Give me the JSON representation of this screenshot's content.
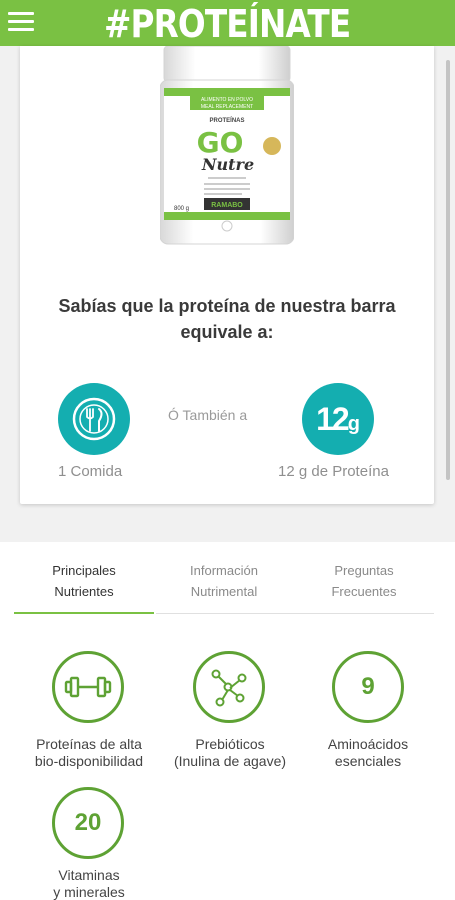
{
  "header": {
    "title": "#PROTEÍNATE",
    "menu_icon": "hamburger-icon"
  },
  "colors": {
    "brand_green": "#7ac143",
    "teal": "#14aeb0",
    "icon_green": "#5ea234"
  },
  "product": {
    "line1": "PROTEÍNAS",
    "brand": "GO",
    "script": "Nutre",
    "banner_top": "ALIMENTO EN POLVO",
    "banner_bottom": "MEAL REPLACEMENT",
    "maker": "RAMABO",
    "weight": "800 g"
  },
  "promo": {
    "line1": "Sabías que la proteína de nuestra barra",
    "line2": "equivale a:"
  },
  "equivalence": {
    "meal_label": "1 Comida",
    "alt_label": "Ó También a",
    "grams_big": "12",
    "grams_unit": "g",
    "protein_label": "12 g de Proteína"
  },
  "tabs": [
    {
      "line1": "Principales",
      "line2": "Nutrientes"
    },
    {
      "line1": "Información",
      "line2": "Nutrimental"
    },
    {
      "line1": "Preguntas",
      "line2": "Frecuentes"
    }
  ],
  "nutrients": [
    {
      "line1": "Proteínas de alta",
      "line2": "bio-disponibilidad",
      "icon": "dumbbell-icon"
    },
    {
      "line1": "Prebióticos",
      "line2": "(Inulina de agave)",
      "icon": "molecule-icon"
    },
    {
      "number": "9",
      "line1": "Aminoácidos",
      "line2": "esenciales"
    },
    {
      "number": "20",
      "line1": "Vitaminas",
      "line2": "y minerales"
    }
  ]
}
